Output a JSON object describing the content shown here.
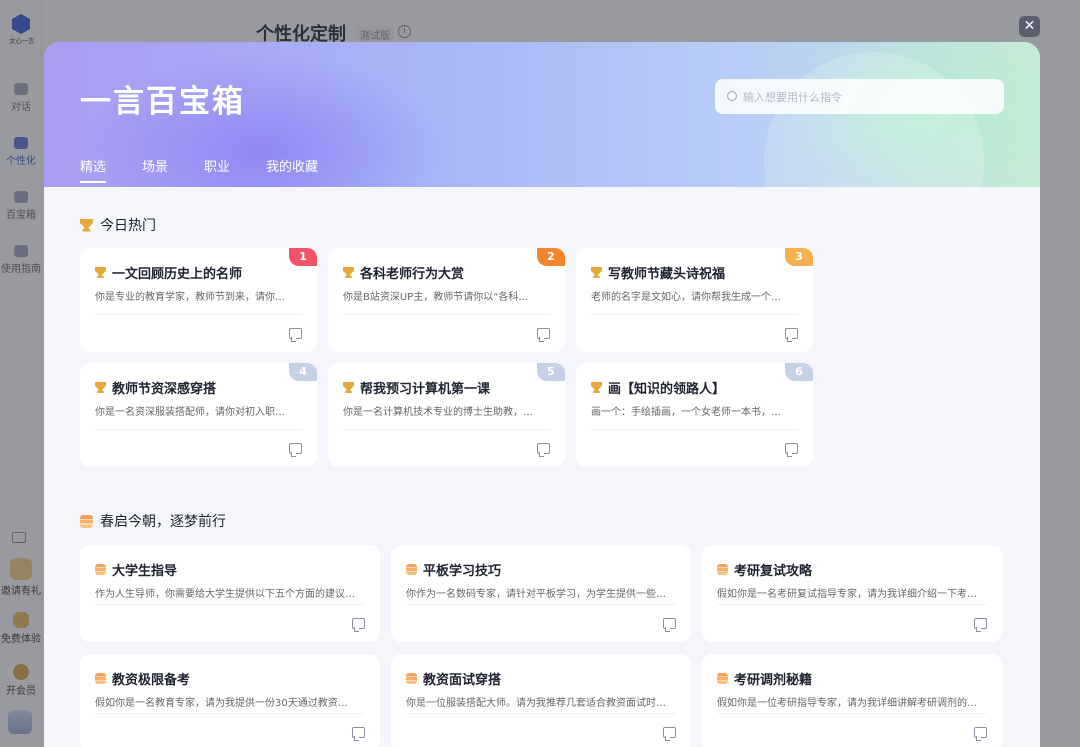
{
  "app": {
    "logo_text": "文心一言",
    "nav": [
      {
        "label": "对话",
        "icon": "chat-icon",
        "active": false
      },
      {
        "label": "个性化",
        "icon": "person-icon",
        "active": true
      },
      {
        "label": "百宝箱",
        "icon": "box-icon",
        "active": false
      },
      {
        "label": "使用指南",
        "icon": "guide-icon",
        "active": false
      }
    ],
    "bottom": [
      {
        "label": "邀请有礼",
        "icon": "gift-icon"
      },
      {
        "label": "免费体验",
        "icon": "ticket-icon"
      },
      {
        "label": "开会员",
        "icon": "member-icon"
      }
    ],
    "page_title": "个性化定制",
    "page_tag": "测试版"
  },
  "modal": {
    "title": "一言百宝箱",
    "search_placeholder": "输入想要用什么指令",
    "close_label": "✕",
    "tabs": [
      "精选",
      "场景",
      "职业",
      "我的收藏"
    ],
    "active_tab": 0
  },
  "hot": {
    "title": "今日热门",
    "items": [
      {
        "rank": "1",
        "rank_color": "#f25367",
        "title": "一文回顾历史上的名师",
        "desc": "你是专业的教育学家，教师节到来，请你…"
      },
      {
        "rank": "2",
        "rank_color": "#f5852c",
        "title": "各科老师行为大赏",
        "desc": "你是B站资深UP主，教师节请你以“各科…"
      },
      {
        "rank": "3",
        "rank_color": "#f5b04f",
        "title": "写教师节藏头诗祝福",
        "desc": "老师的名字是文如心，请你帮我生成一个…"
      },
      {
        "rank": "4",
        "rank_color": "#c6d0e6",
        "title": "教师节资深感穿搭",
        "desc": "你是一名资深服装搭配师，请你对初入职…"
      },
      {
        "rank": "5",
        "rank_color": "#c6d0e6",
        "title": "帮我预习计算机第一课",
        "desc": "你是一名计算机技术专业的博士生助教，…"
      },
      {
        "rank": "6",
        "rank_color": "#c6d0e6",
        "title": "画【知识的领路人】",
        "desc": "画一个：手绘插画，一个女老师一本书，…"
      }
    ]
  },
  "spring": {
    "title": "春启今朝，逐梦前行",
    "items": [
      {
        "title": "大学生指导",
        "desc": "作为人生导师，你需要给大学生提供以下五个方面的建议…"
      },
      {
        "title": "平板学习技巧",
        "desc": "你作为一名数码专家，请针对平板学习，为学生提供一些…"
      },
      {
        "title": "考研复试攻略",
        "desc": "假如你是一名考研复试指导专家，请为我详细介绍一下考…"
      },
      {
        "title": "教资极限备考",
        "desc": "假如你是一名教育专家，请为我提供一份30天通过教资…"
      },
      {
        "title": "教资面试穿搭",
        "desc": "你是一位服装搭配大师。请为我推荐几套适合教资面试时…"
      },
      {
        "title": "考研调剂秘籍",
        "desc": "假如你是一位考研指导专家，请为我详细讲解考研调剂的…"
      }
    ]
  }
}
